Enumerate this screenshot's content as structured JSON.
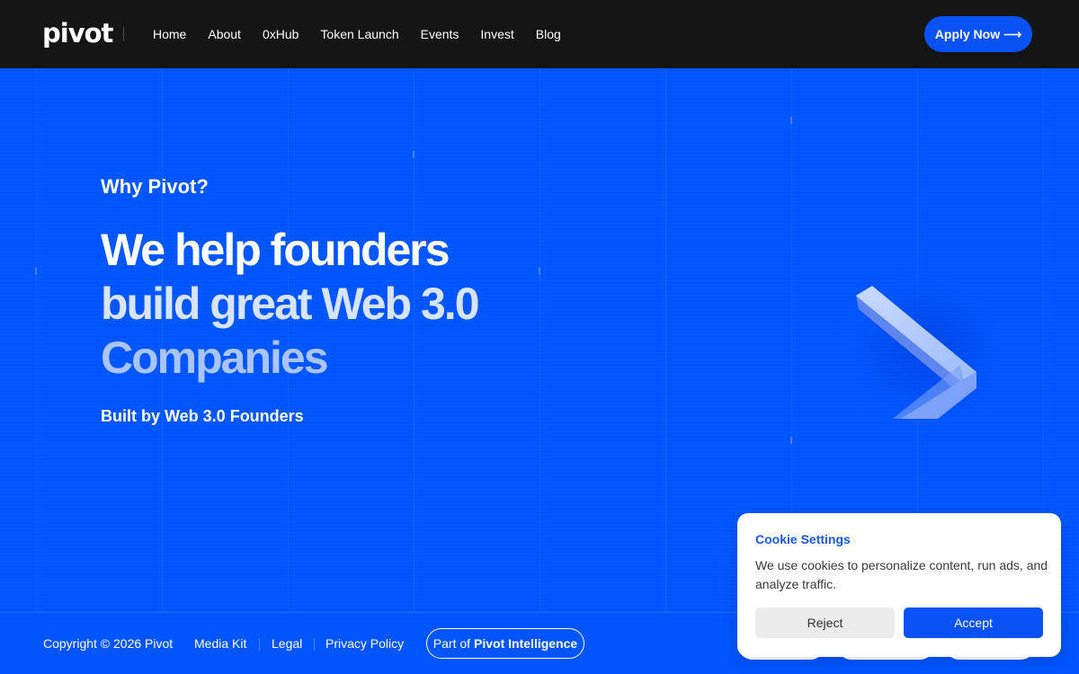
{
  "header": {
    "logo": "pivot",
    "nav": [
      "Home",
      "About",
      "0xHub",
      "Token Launch",
      "Events",
      "Invest",
      "Blog"
    ],
    "apply_label": "Apply Now",
    "apply_arrow": "⟶"
  },
  "hero": {
    "eyebrow": "Why Pivot?",
    "headline_line1": "We help founders",
    "headline_line2": "build great Web 3.0",
    "headline_line3": "Companies",
    "subline": "Built by Web 3.0 Founders",
    "graphic_icon": "chevron-right-icon"
  },
  "footer": {
    "copyright": "Copyright © 2026 Pivot",
    "media_kit": "Media Kit",
    "legal": "Legal",
    "privacy": "Privacy Policy",
    "part_of_prefix": "Part of",
    "part_of_brand": "Pivot Intelligence"
  },
  "cookie": {
    "title": "Cookie Settings",
    "text": "We use cookies to personalize content, run ads, and analyze traffic.",
    "reject": "Reject",
    "accept": "Accept"
  },
  "colors": {
    "brand_blue": "#0055ff",
    "header_bg": "#151515",
    "accent_button": "#0a52f5",
    "cookie_title": "#1a56e6"
  }
}
